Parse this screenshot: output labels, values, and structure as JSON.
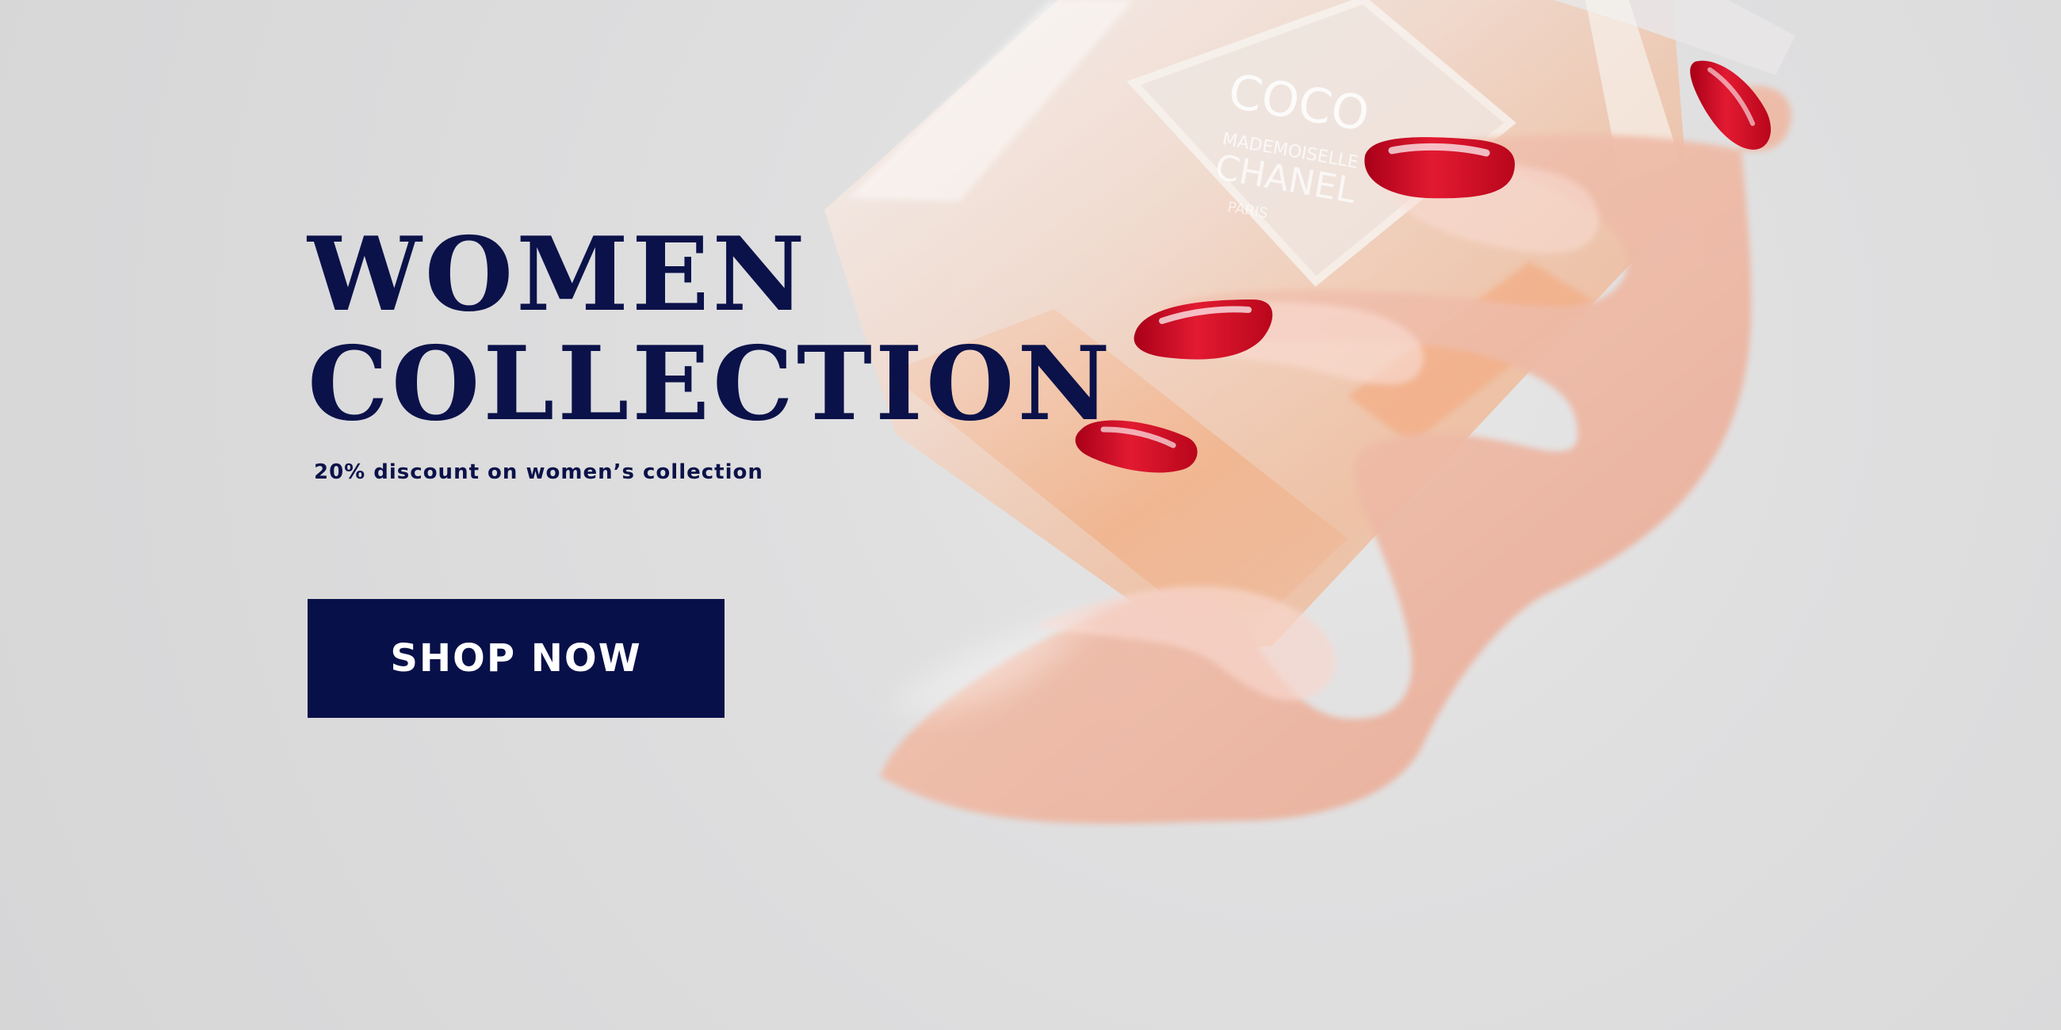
{
  "hero": {
    "headline_line_1": "WOMEN",
    "headline_line_2": "COLLECTION",
    "subtitle": "20% discount on women’s collection",
    "cta_label": "SHOP NOW"
  },
  "product_image": {
    "label_line_1": "COCO",
    "label_line_2": "MADEMOISELLE",
    "label_line_3": "CHANEL",
    "label_line_4": "PARIS"
  },
  "colors": {
    "background": "#dcdcdd",
    "headline": "#0b1249",
    "button_background": "#081049",
    "button_text": "#ffffff",
    "nail_polish": "#c40b22",
    "perfume": "#f0a376"
  },
  "icons": {
    "hero_image": "perfume-bottle-hand-image"
  }
}
